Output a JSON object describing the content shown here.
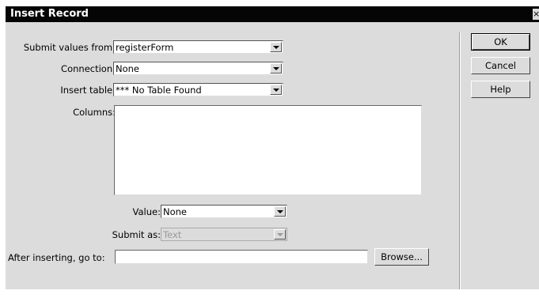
{
  "dialog": {
    "title": "Insert Record",
    "close_glyph": "×"
  },
  "form": {
    "submit_values_from": {
      "label": "Submit values from:",
      "value": "registerForm"
    },
    "connection": {
      "label": "Connection:",
      "value": "None"
    },
    "insert_table": {
      "label": "Insert table:",
      "value": "*** No Table Found"
    },
    "columns": {
      "label": "Columns:",
      "items": []
    },
    "value": {
      "label": "Value:",
      "value": "None"
    },
    "submit_as": {
      "label": "Submit as:",
      "value": "Text",
      "disabled": true
    },
    "after_inserting": {
      "label": "After inserting, go to:",
      "value": ""
    },
    "browse_label": "Browse..."
  },
  "buttons": {
    "ok": "OK",
    "cancel": "Cancel",
    "help": "Help"
  },
  "icons": {
    "dropdown": "chevron-down-icon",
    "close": "close-icon"
  }
}
